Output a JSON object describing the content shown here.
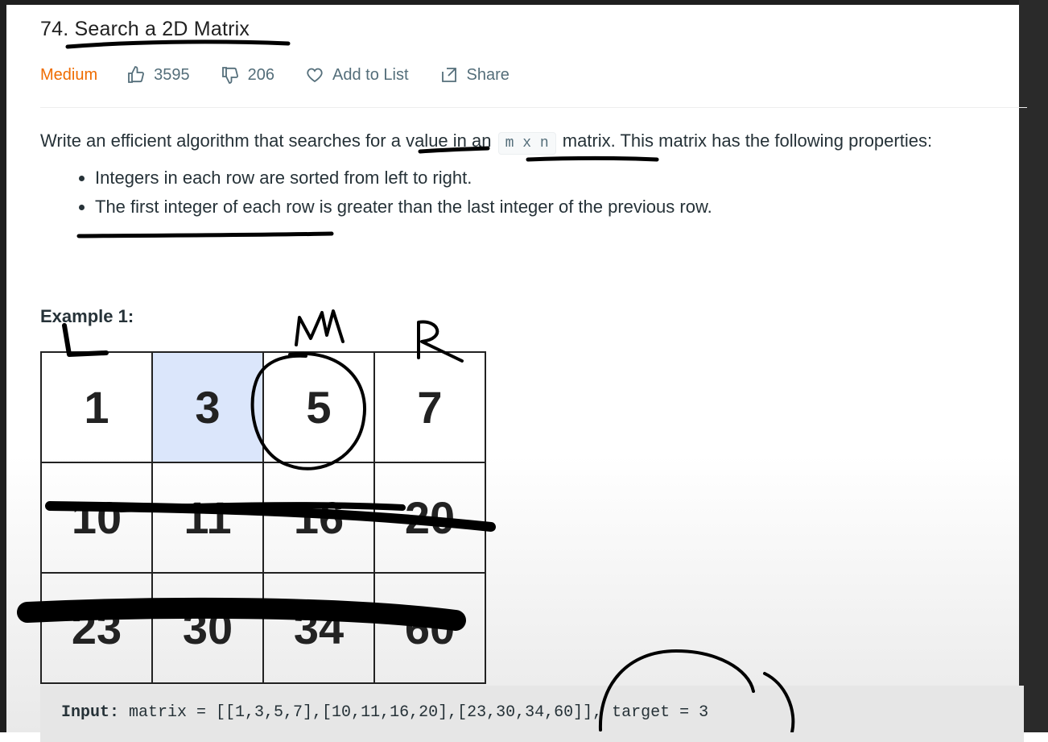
{
  "problem": {
    "title": "74. Search a 2D Matrix",
    "difficulty": "Medium",
    "likes": "3595",
    "dislikes": "206",
    "add_to_list": "Add to List",
    "share": "Share"
  },
  "description": {
    "before": "Write an efficient algorithm that searches for a value in an",
    "code": "m x n",
    "after": "matrix. This matrix has the following properties:",
    "bullets": [
      "Integers in each row are sorted from left to right.",
      "The first integer of each row is greater than the last integer of the previous row."
    ]
  },
  "example": {
    "title": "Example 1:",
    "matrix": [
      [
        "1",
        "3",
        "5",
        "7"
      ],
      [
        "10",
        "11",
        "16",
        "20"
      ],
      [
        "23",
        "30",
        "34",
        "60"
      ]
    ],
    "input_label": "Input:",
    "input_text": " matrix = [[1,3,5,7],[10,11,16,20],[23,30,34,60]], target = 3"
  },
  "annotations": {
    "left_marker": "L",
    "mid_marker": "M",
    "right_marker": "R",
    "ink_color": "#000000"
  }
}
